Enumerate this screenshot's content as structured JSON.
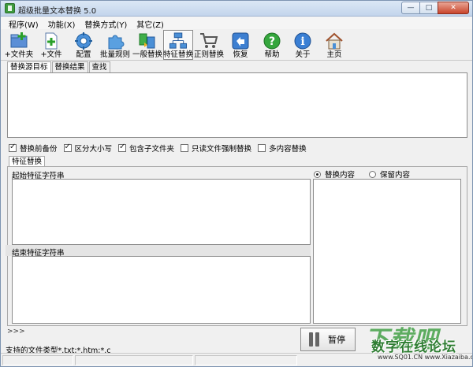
{
  "window": {
    "title": "超级批量文本替换 5.0"
  },
  "menu": [
    "程序(W)",
    "功能(X)",
    "替换方式(Y)",
    "其它(Z)"
  ],
  "toolbar": [
    {
      "name": "add-folder",
      "label": "+文件夹",
      "icon": "folder-plus-icon"
    },
    {
      "name": "add-file",
      "label": "+文件",
      "icon": "file-plus-icon"
    },
    {
      "name": "config",
      "label": "配置",
      "icon": "gear-icon"
    },
    {
      "name": "batch-rules",
      "label": "批量规则",
      "icon": "puzzle-icon"
    },
    {
      "name": "normal-replace",
      "label": "一般替换",
      "icon": "replace-icon"
    },
    {
      "name": "feature-replace",
      "label": "特征替换",
      "icon": "network-icon",
      "active": true
    },
    {
      "name": "regex-replace",
      "label": "正则替换",
      "icon": "cart-icon"
    },
    {
      "name": "restore",
      "label": "恢复",
      "icon": "undo-arrow-icon"
    },
    {
      "name": "help",
      "label": "帮助",
      "icon": "question-icon"
    },
    {
      "name": "about",
      "label": "关于",
      "icon": "info-icon"
    },
    {
      "name": "home",
      "label": "主页",
      "icon": "house-icon"
    }
  ],
  "source_tabs": [
    "替换源目标",
    "替换结果",
    "查找"
  ],
  "options": [
    {
      "label": "替换前备份",
      "checked": true
    },
    {
      "label": "区分大小写",
      "checked": true
    },
    {
      "label": "包含子文件夹",
      "checked": true
    },
    {
      "label": "只读文件强制替换",
      "checked": false
    },
    {
      "label": "多内容替换",
      "checked": false
    }
  ],
  "feature": {
    "tab": "特征替换",
    "start_label": "起始特征字符串",
    "end_label": "结束特征字符串",
    "radios": [
      {
        "label": "替换内容",
        "selected": true
      },
      {
        "label": "保留内容",
        "selected": false
      }
    ]
  },
  "log": {
    "prompt": ">>>"
  },
  "pause": {
    "label": "暂停"
  },
  "support": {
    "text": "支持的文件类型*.txt;*.htm;*.c"
  },
  "watermark": {
    "big": "下载吧",
    "mid": "数字在线论坛",
    "url": "www.SQ01.CN www.Xiazaiba.com"
  },
  "colors": {
    "titlebar": "#c3d5ec",
    "accent_green": "#43a047",
    "close_red": "#c9452c"
  }
}
